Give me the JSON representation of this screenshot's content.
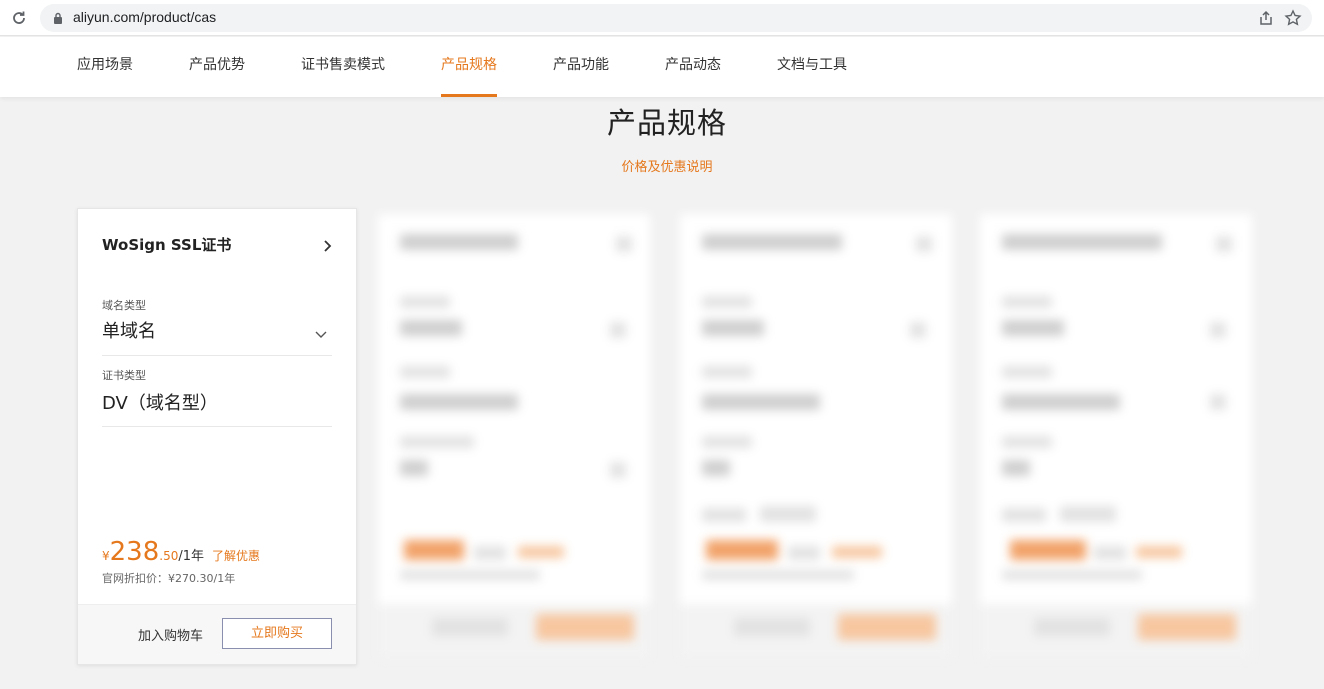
{
  "browser": {
    "url": "aliyun.com/product/cas"
  },
  "nav": {
    "tabs": [
      {
        "label": "应用场景"
      },
      {
        "label": "产品优势"
      },
      {
        "label": "证书售卖模式"
      },
      {
        "label": "产品规格",
        "active": true
      },
      {
        "label": "产品功能"
      },
      {
        "label": "产品动态"
      },
      {
        "label": "文档与工具"
      }
    ]
  },
  "section": {
    "title": "产品规格",
    "price_link": "价格及优惠说明"
  },
  "card": {
    "title": "WoSign SSL证书",
    "fields": [
      {
        "label": "域名类型",
        "value": "单域名"
      },
      {
        "label": "证书类型",
        "value": "DV（域名型）"
      }
    ],
    "price": {
      "currency": "¥",
      "integer": "238",
      "decimal": ".50",
      "unit": "/1年",
      "discount_link": "了解优惠",
      "official": "官网折扣价：¥270.30/1年"
    },
    "add_to_cart": "加入购物车",
    "buy_now": "立即购买"
  },
  "colors": {
    "accent": "#e5781d",
    "background": "#f2f2f2"
  }
}
